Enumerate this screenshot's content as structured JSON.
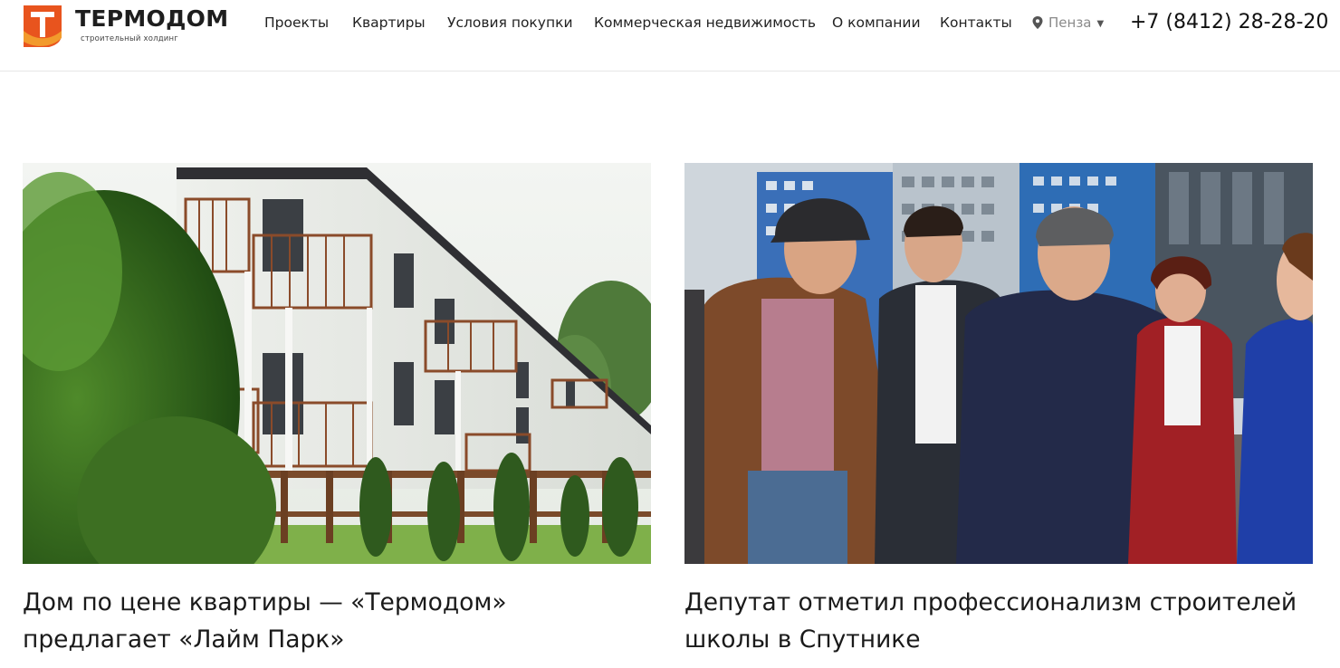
{
  "brand": {
    "name": "ТЕРМОДОМ",
    "tagline": "строительный холдинг",
    "logo_letter": "Т",
    "colors": {
      "accent": "#e8541e",
      "accent_light": "#f29a2c"
    }
  },
  "nav": {
    "items": [
      {
        "label": "Проекты"
      },
      {
        "label": "Квартиры"
      },
      {
        "label": "Условия покупки"
      },
      {
        "label": "Коммерческая недвижимость"
      },
      {
        "label": "О компании"
      },
      {
        "label": "Контакты"
      }
    ]
  },
  "city": {
    "label": "Пенза",
    "icon": "map-pin-icon",
    "dropdown_icon": "caret-down-icon"
  },
  "phone": "+7 (8412) 28-28-20",
  "news": [
    {
      "title": "Дом по цене квартиры — «Термодом» предлагает «Лайм Парк»",
      "image": "townhouses-photo"
    },
    {
      "title": "Депутат отметил профессионализм строителей школы в Спутнике",
      "image": "officials-at-construction-photo"
    }
  ]
}
